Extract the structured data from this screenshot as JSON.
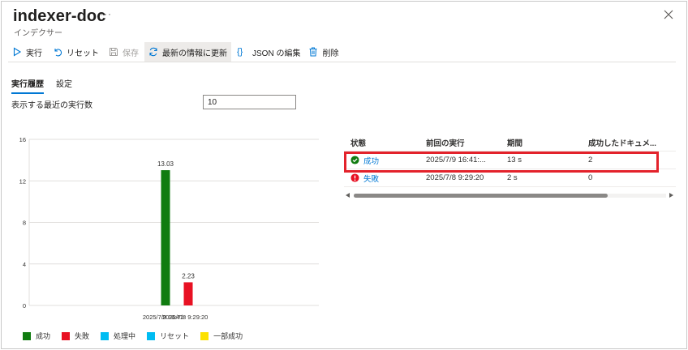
{
  "header": {
    "title": "indexer-doc",
    "more": "···",
    "subtitle": "インデクサー"
  },
  "toolbar": {
    "run": "実行",
    "reset": "リセット",
    "save": "保存",
    "refresh": "最新の情報に更新",
    "json_edit": "JSON の編集",
    "delete": "削除"
  },
  "tabs": {
    "history": "実行履歴",
    "settings": "設定"
  },
  "runs": {
    "label": "表示する最近の実行数",
    "value": "10"
  },
  "chart_data": {
    "type": "bar",
    "categories": [
      "2025/7/9 16:41:...",
      "2025/7/8 9:29:20"
    ],
    "category_labels": [
      "2025/7/9 16:41:",
      "2025/7/8 9:29:20"
    ],
    "series": [
      {
        "name": "成功",
        "values": [
          13.03,
          null
        ],
        "color": "#107c10"
      },
      {
        "name": "失敗",
        "values": [
          null,
          2.23
        ],
        "color": "#e81123"
      }
    ],
    "data_labels": [
      "13.03",
      "2.23"
    ],
    "yticks": [
      "0",
      "4",
      "8",
      "12",
      "16"
    ],
    "ylim": [
      0,
      16
    ],
    "grid": true,
    "legend_position": "bottom-left"
  },
  "legend": [
    {
      "label": "成功",
      "color": "#107c10"
    },
    {
      "label": "失敗",
      "color": "#e81123"
    },
    {
      "label": "処理中",
      "color": "#00bcf2"
    },
    {
      "label": "リセット",
      "color": "#00bcf2"
    },
    {
      "label": "一部成功",
      "color": "#fce100"
    }
  ],
  "table": {
    "columns": [
      "状態",
      "前回の実行",
      "期間",
      "成功したドキュメ..."
    ],
    "rows": [
      {
        "status": "成功",
        "status_icon": "check-circle-icon",
        "status_color": "#107c10",
        "last_run": "2025/7/9 16:41:...",
        "duration": "13 s",
        "succeeded": "2"
      },
      {
        "status": "失敗",
        "status_icon": "error-circle-icon",
        "status_color": "#e81123",
        "last_run": "2025/7/8 9:29:20",
        "duration": "2 s",
        "succeeded": "0"
      }
    ]
  },
  "colors": {
    "accent": "#0078d4",
    "highlight": "#e3222b"
  }
}
